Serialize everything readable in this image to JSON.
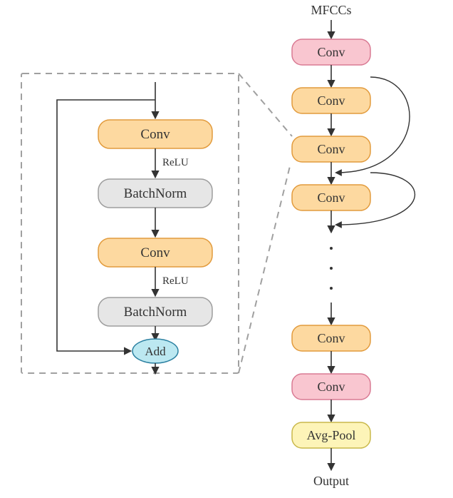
{
  "input_label": "MFCCs",
  "output_label": "Output",
  "main_chain": {
    "first_conv": "Conv",
    "res_blocks": [
      "Conv",
      "Conv",
      "Conv",
      "Conv"
    ],
    "last_conv": "Conv",
    "pool": "Avg-Pool"
  },
  "detail_box": {
    "conv1": "Conv",
    "act1": "ReLU",
    "bn1": "BatchNorm",
    "conv2": "Conv",
    "act2": "ReLU",
    "bn2": "BatchNorm",
    "add": "Add"
  },
  "colors": {
    "conv_orange_fill": "#fdd9a0",
    "conv_orange_stroke": "#e29b3d",
    "conv_pink_fill": "#f9c6d0",
    "conv_pink_stroke": "#d97a93",
    "bn_fill": "#e6e6e6",
    "bn_stroke": "#9e9e9e",
    "add_fill": "#bce8f1",
    "add_stroke": "#2a7fa0",
    "pool_fill": "#fdf4b8",
    "pool_stroke": "#c9b84a",
    "dash_stroke": "#a0a0a0",
    "arrow": "#333333"
  }
}
